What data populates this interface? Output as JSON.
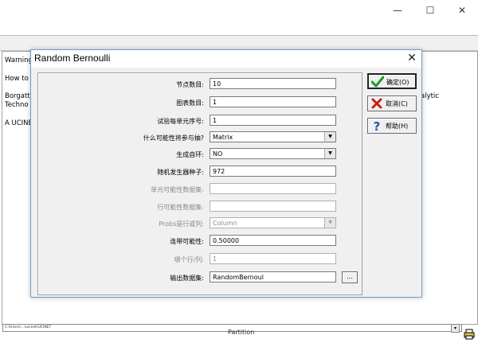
{
  "background": {
    "window_controls": {
      "minimize": "—",
      "maximize": "☐",
      "close": "✕"
    },
    "text_lines": [
      "Warning",
      "How to",
      "Borgatti",
      "Techno",
      "A UCINE"
    ],
    "right_fragment": "alytic",
    "status_path": "C:\\Users\\...\\ucinet\\UCINET",
    "status_button": "▾",
    "bottom_label": "Partition"
  },
  "dialog": {
    "title": "Random Bernoulli",
    "close": "✕",
    "fields": [
      {
        "label": "节点数目:",
        "value": "10",
        "enabled": true,
        "type": "text"
      },
      {
        "label": "图表数目:",
        "value": "1",
        "enabled": true,
        "type": "text"
      },
      {
        "label": "试验每单元序号:",
        "value": "1",
        "enabled": true,
        "type": "text"
      },
      {
        "label": "什么可能性将参与抽?",
        "value": "Matrix",
        "enabled": true,
        "type": "combo"
      },
      {
        "label": "生成自环:",
        "value": "NO",
        "enabled": true,
        "type": "combo"
      },
      {
        "label": "随机发生器种子:",
        "value": "972",
        "enabled": true,
        "type": "text"
      },
      {
        "label": "单元可能性数据集:",
        "value": "",
        "enabled": false,
        "type": "text"
      },
      {
        "label": "行可能性数据集:",
        "value": "",
        "enabled": false,
        "type": "text"
      },
      {
        "label": "Probs是行或列:",
        "value": "Column",
        "enabled": false,
        "type": "combo"
      },
      {
        "label": "连带可能性:",
        "value": "0.50000",
        "enabled": true,
        "type": "text"
      },
      {
        "label": "哪个行/列:",
        "value": "1",
        "enabled": false,
        "type": "text"
      },
      {
        "label": "输出数据集:",
        "value": "RandomBernoul",
        "enabled": true,
        "type": "text"
      }
    ],
    "combo_arrow": "▼",
    "browse_label": "...",
    "buttons": {
      "ok": "确定(O)",
      "cancel": "取消(C)",
      "help": "帮助(H)"
    }
  }
}
